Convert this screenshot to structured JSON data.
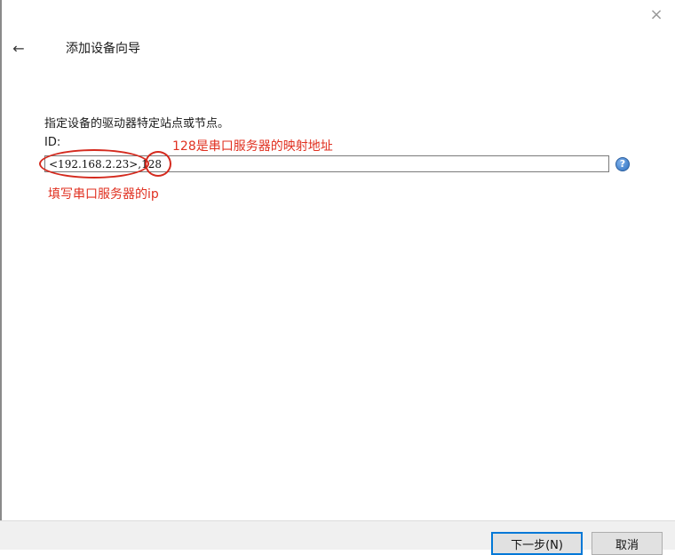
{
  "window": {
    "close_glyph": "×",
    "back_glyph": "←",
    "title": "添加设备向导"
  },
  "form": {
    "instruction": "指定设备的驱动器特定站点或节点。",
    "id_label": "ID:",
    "id_value": "<192.168.2.23>,128",
    "help_glyph": "?"
  },
  "annotations": {
    "port_note": "128是串口服务器的映射地址",
    "ip_note": "填写串口服务器的ip",
    "color": "#e03020"
  },
  "footer": {
    "next_label": "下一步(N)",
    "cancel_label": "取消"
  }
}
